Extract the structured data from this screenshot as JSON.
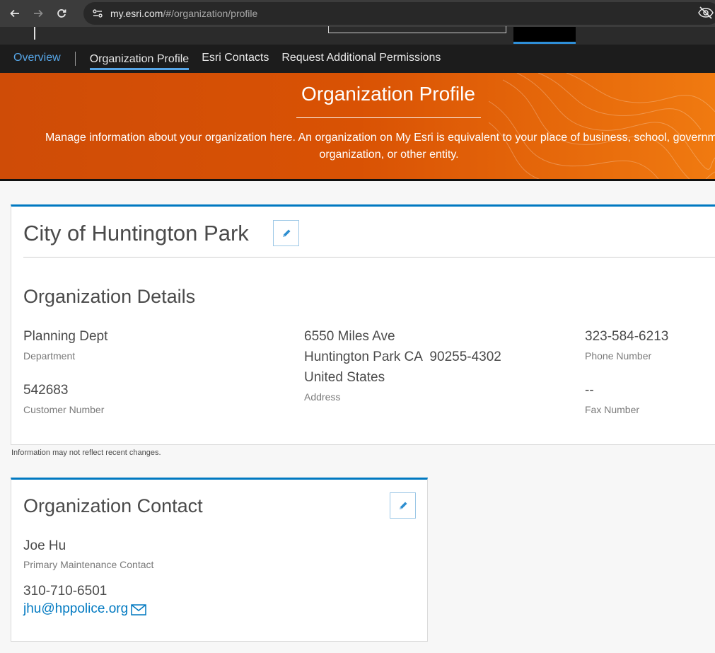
{
  "browser": {
    "url_host": "my.esri.com",
    "url_path": "/#/organization/profile"
  },
  "subnav": {
    "items": [
      {
        "label": "Overview"
      },
      {
        "label": "Organization Profile"
      },
      {
        "label": "Esri Contacts"
      },
      {
        "label": "Request Additional Permissions"
      }
    ]
  },
  "hero": {
    "title": "Organization Profile",
    "description": "Manage information about your organization here. An organization on My Esri is equivalent to your place of business, school, government organization, or other entity."
  },
  "organization": {
    "name": "City of Huntington Park",
    "details_title": "Organization Details",
    "department_value": "Planning Dept",
    "department_label": "Department",
    "customer_number_value": "542683",
    "customer_number_label": "Customer Number",
    "address_line1": "6550 Miles Ave",
    "address_line2": "Huntington Park CA  90255-4302",
    "address_line3": "United States",
    "address_label": "Address",
    "phone_value": "323-584-6213",
    "phone_label": "Phone Number",
    "fax_value": "--",
    "fax_label": "Fax Number"
  },
  "note": "Information may not reflect recent changes.",
  "contact": {
    "title": "Organization Contact",
    "name": "Joe Hu",
    "role": "Primary Maintenance Contact",
    "phone": "310-710-6501",
    "email": "jhu@hppolice.org"
  },
  "colors": {
    "accent": "#0079c1",
    "hero_orange": "#d95204",
    "nav_active": "#56a5e6"
  }
}
